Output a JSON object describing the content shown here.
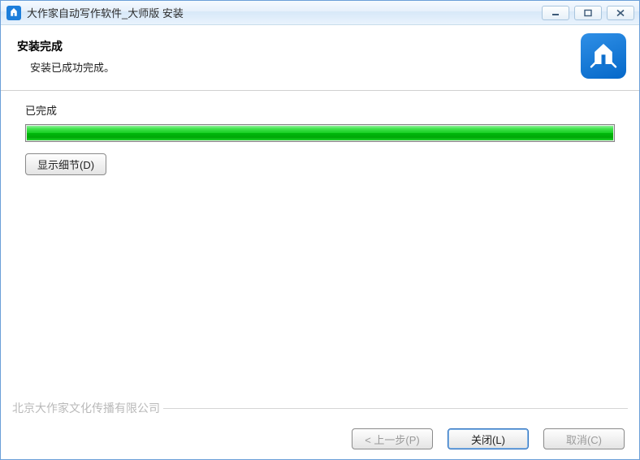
{
  "titlebar": {
    "title": "大作家自动写作软件_大师版 安装"
  },
  "header": {
    "heading": "安装完成",
    "subheading": "安装已成功完成。"
  },
  "body": {
    "status_label": "已完成",
    "progress_percent": 100,
    "details_button": "显示细节(D)"
  },
  "branding": "北京大作家文化传播有限公司",
  "footer": {
    "back": "< 上一步(P)",
    "close": "关闭(L)",
    "cancel": "取消(C)"
  },
  "icons": {
    "app": "pen-crown-icon",
    "minimize": "minimize-icon",
    "maximize": "maximize-icon",
    "closewin": "close-icon"
  }
}
